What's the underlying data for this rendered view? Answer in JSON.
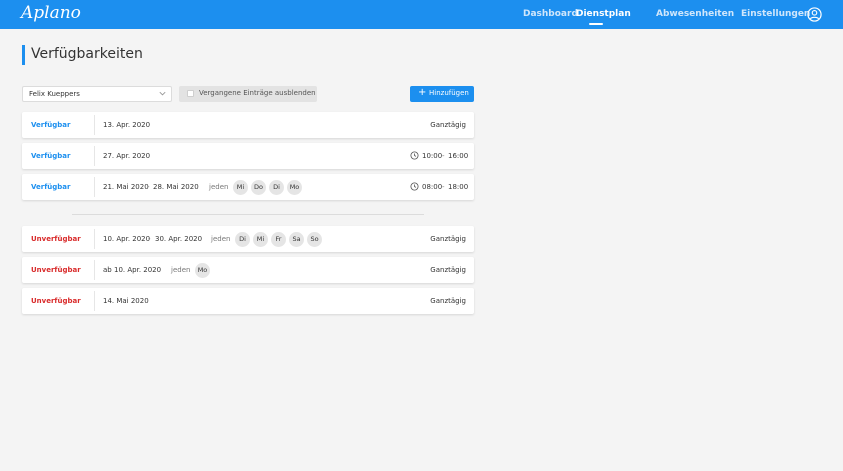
{
  "app": {
    "logo": "Aplano"
  },
  "nav": {
    "items": [
      {
        "label": "Dashboard"
      },
      {
        "label": "Dienstplan"
      },
      {
        "label": "Abwesenheiten"
      },
      {
        "label": "Einstellungen"
      }
    ],
    "active": "Dienstplan",
    "user_icon": "user-circle-icon"
  },
  "page": {
    "title": "Verfügbarkeiten"
  },
  "filters": {
    "employee_select_value": "Felix Kueppers",
    "hide_past_label": "Vergangene Einträge ausblenden",
    "hide_past_checked": false,
    "add_button_label": "Hinzufügen"
  },
  "available_entries": [
    {
      "status": "Verfügbar",
      "start": "13. Apr. 2020",
      "time": "Ganztägig"
    },
    {
      "status": "Verfügbar",
      "start": "27. Apr. 2020",
      "time_from": "10:00",
      "time_sep": "-",
      "time_to": "16:00"
    },
    {
      "status": "Verfügbar",
      "start": "21. Mai 2020",
      "range_sep": "-",
      "end": "28. Mai 2020",
      "repeat": "jeden",
      "days": [
        "Mi",
        "Do",
        "Di",
        "Mo"
      ],
      "time_from": "08:00",
      "time_sep": "-",
      "time_to": "18:00"
    }
  ],
  "unavailable_entries": [
    {
      "status": "Unverfügbar",
      "start": "10. Apr. 2020",
      "range_sep": "-",
      "end": "30. Apr. 2020",
      "repeat": "jeden",
      "days": [
        "Di",
        "Mi",
        "Fr",
        "Sa",
        "So"
      ],
      "time": "Ganztägig"
    },
    {
      "status": "Unverfügbar",
      "prefix": "ab",
      "start": "10. Apr. 2020",
      "repeat": "jeden",
      "days": [
        "Mo"
      ],
      "time": "Ganztägig"
    },
    {
      "status": "Unverfügbar",
      "start": "14. Mai 2020",
      "time": "Ganztägig"
    }
  ],
  "colors": {
    "primary": "#1c8fef",
    "available": "#1c8fef",
    "unavailable": "#d92b2b",
    "background": "#f4f4f4"
  }
}
